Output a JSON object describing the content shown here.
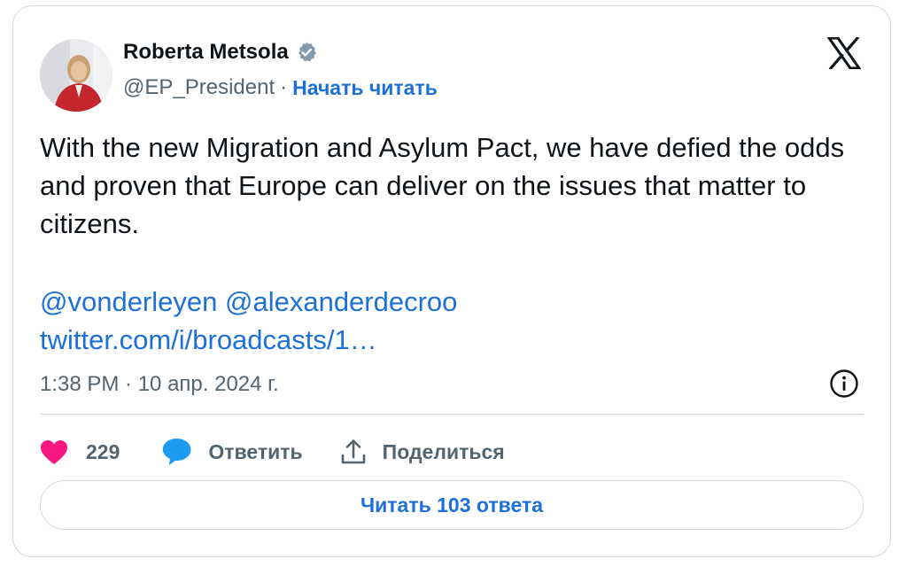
{
  "author": {
    "name": "Roberta Metsola",
    "handle": "@EP_President",
    "separator": "·",
    "follow_label": "Начать читать"
  },
  "tweet": {
    "text": "With the new Migration and Asylum Pact, we have defied the odds and proven that Europe can deliver on the issues that matter to citizens.",
    "mentions": [
      "@vonderleyen",
      "@alexanderdecroo"
    ],
    "link": "twitter.com/i/broadcasts/1…",
    "timestamp": "1:38 PM · 10 апр. 2024 г."
  },
  "actions": {
    "like_count": "229",
    "reply_label": "Ответить",
    "share_label": "Поделиться"
  },
  "read_replies_label": "Читать 103 ответа",
  "icons": [
    "verified-badge-icon",
    "x-logo-icon",
    "info-icon",
    "heart-icon",
    "reply-bubble-icon",
    "share-icon"
  ],
  "colors": {
    "link_blue": "#1d70d8",
    "heart_pink": "#f91880",
    "reply_blue": "#1d9bf0",
    "muted": "#536471",
    "border": "#cfd9de"
  }
}
